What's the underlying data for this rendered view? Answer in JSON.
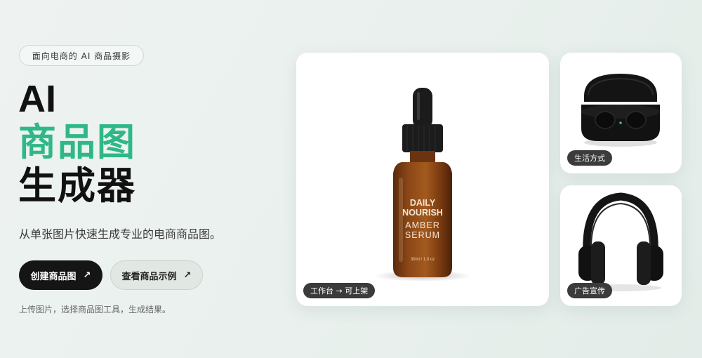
{
  "tag": "面向电商的 AI 商品摄影",
  "headline": {
    "line1": "AI",
    "line2": "商品图",
    "line3": "生成器"
  },
  "subtitle": "从单张图片快速生成专业的电商商品图。",
  "buttons": {
    "primary": "创建商品图",
    "secondary": "查看商品示例",
    "arrow": "↗"
  },
  "hint": "上传图片，选择商品图工具，生成结果。",
  "cards": {
    "main": {
      "badge": "工作台 → 可上架",
      "label_daily": "DAILY",
      "label_nourish": "NOURISH",
      "label_amber": "AMBER",
      "label_serum": "SERUM",
      "label_volume": "30ml / 1.0 oz"
    },
    "top": {
      "badge": "生活方式"
    },
    "bottom": {
      "badge": "广告宣传"
    }
  },
  "colors": {
    "accent": "#2fb887",
    "dark": "#151515",
    "badge": "#3b3b3b"
  }
}
